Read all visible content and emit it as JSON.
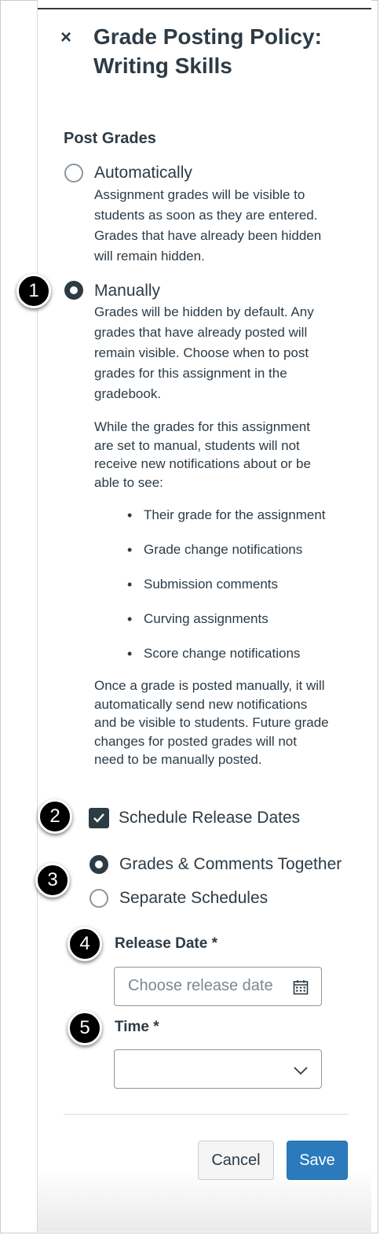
{
  "tray": {
    "title_line1": "Grade Posting Policy:",
    "title_line2": "Writing Skills",
    "close_glyph": "×"
  },
  "post_grades": {
    "heading": "Post Grades",
    "automatic": {
      "label": "Automatically",
      "selected": false,
      "description_lines": [
        "Assignment grades will be visible to",
        "students as soon as they are entered.",
        "Grades that have already been hidden",
        "will remain hidden."
      ]
    },
    "manual": {
      "label": "Manually",
      "selected": true,
      "description_lines": [
        "Grades will be hidden by default. Any",
        "grades that have already posted will",
        "remain visible. Choose when to post",
        "grades for this assignment in the",
        "gradebook."
      ],
      "notice_lines": [
        "While the grades for this assignment",
        "are set to manual, students will not",
        "receive new notifications about or be",
        "able to see:"
      ],
      "bullets": [
        "Their grade for the assignment",
        "Grade change notifications",
        "Submission comments",
        "Curving assignments",
        "Score change notifications"
      ],
      "footer_lines": [
        "Once a grade is posted manually, it will",
        "automatically send new notifications",
        "and be visible to students. Future grade",
        "changes for posted grades will not",
        "need to be manually posted."
      ]
    }
  },
  "schedule": {
    "checkbox_label": "Schedule Release Dates",
    "checked": true,
    "options": [
      {
        "label": "Grades & Comments Together",
        "selected": true
      },
      {
        "label": "Separate Schedules",
        "selected": false
      }
    ],
    "release_date": {
      "label": "Release Date *",
      "placeholder": "Choose release date",
      "icon": "calendar-icon"
    },
    "time": {
      "label": "Time *",
      "value": "",
      "icon": "chevron-down-icon"
    }
  },
  "actions": {
    "cancel": "Cancel",
    "save": "Save"
  },
  "callouts": [
    "1",
    "2",
    "3",
    "4",
    "5"
  ],
  "colors": {
    "text": "#2d3b45",
    "primary": "#2b7abc",
    "border": "#8b969e"
  }
}
